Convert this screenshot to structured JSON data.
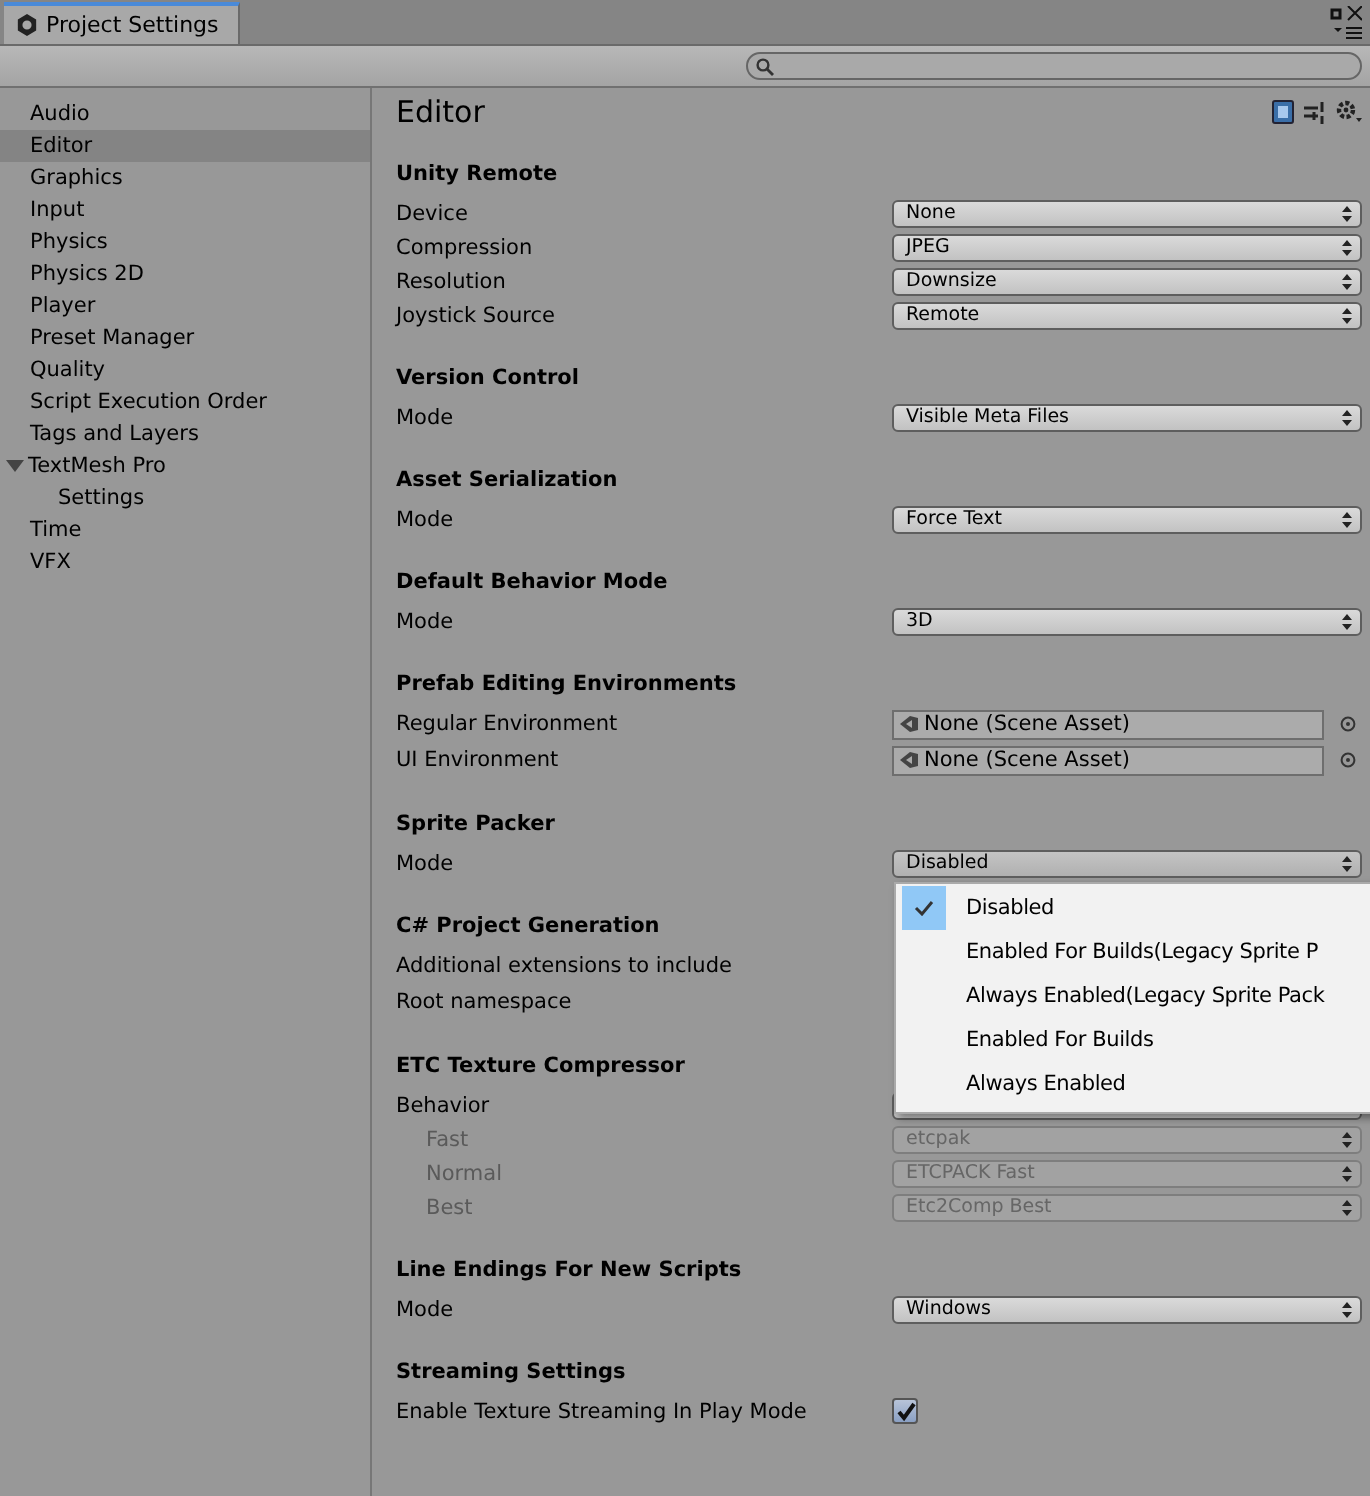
{
  "window": {
    "tab": "Project Settings"
  },
  "sidebar": {
    "items": [
      {
        "label": "Audio",
        "selected": false
      },
      {
        "label": "Editor",
        "selected": true
      },
      {
        "label": "Graphics",
        "selected": false
      },
      {
        "label": "Input",
        "selected": false
      },
      {
        "label": "Physics",
        "selected": false
      },
      {
        "label": "Physics 2D",
        "selected": false
      },
      {
        "label": "Player",
        "selected": false
      },
      {
        "label": "Preset Manager",
        "selected": false
      },
      {
        "label": "Quality",
        "selected": false
      },
      {
        "label": "Script Execution Order",
        "selected": false
      },
      {
        "label": "Tags and Layers",
        "selected": false
      },
      {
        "label": "TextMesh Pro",
        "selected": false,
        "expanded": true,
        "children": [
          {
            "label": "Settings",
            "selected": false
          }
        ]
      },
      {
        "label": "Time",
        "selected": false
      },
      {
        "label": "VFX",
        "selected": false
      }
    ]
  },
  "panel": {
    "title": "Editor",
    "sections": [
      {
        "title": "Unity Remote",
        "rows": [
          {
            "kind": "popup",
            "label": "Device",
            "value": "None",
            "disabled": false
          },
          {
            "kind": "popup",
            "label": "Compression",
            "value": "JPEG",
            "disabled": false
          },
          {
            "kind": "popup",
            "label": "Resolution",
            "value": "Downsize",
            "disabled": false
          },
          {
            "kind": "popup",
            "label": "Joystick Source",
            "value": "Remote",
            "disabled": false
          }
        ]
      },
      {
        "title": "Version Control",
        "rows": [
          {
            "kind": "popup",
            "label": "Mode",
            "value": "Visible Meta Files",
            "disabled": false
          }
        ]
      },
      {
        "title": "Asset Serialization",
        "rows": [
          {
            "kind": "popup",
            "label": "Mode",
            "value": "Force Text",
            "disabled": false
          }
        ]
      },
      {
        "title": "Default Behavior Mode",
        "rows": [
          {
            "kind": "popup",
            "label": "Mode",
            "value": "3D",
            "disabled": false
          }
        ]
      },
      {
        "title": "Prefab Editing Environments",
        "rows": [
          {
            "kind": "object",
            "label": "Regular Environment",
            "value": "None (Scene Asset)"
          },
          {
            "kind": "object",
            "label": "UI Environment",
            "value": "None (Scene Asset)"
          }
        ]
      },
      {
        "title": "Sprite Packer",
        "rows": [
          {
            "kind": "popup",
            "label": "Mode",
            "value": "Disabled",
            "disabled": false,
            "open": true
          }
        ]
      },
      {
        "title": "C# Project Generation",
        "rows": [
          {
            "kind": "text",
            "label": "Additional extensions to include"
          },
          {
            "kind": "text",
            "label": "Root namespace"
          }
        ]
      },
      {
        "title": "ETC Texture Compressor",
        "rows": [
          {
            "kind": "popup",
            "label": "Behavior",
            "disabled": false,
            "children": [
              {
                "kind": "popup",
                "label": "Fast",
                "value": "etcpak",
                "disabled": true
              },
              {
                "kind": "popup",
                "label": "Normal",
                "value": "ETCPACK Fast",
                "disabled": true
              },
              {
                "kind": "popup",
                "label": "Best",
                "value": "Etc2Comp Best",
                "disabled": true
              }
            ]
          }
        ]
      },
      {
        "title": "Line Endings For New Scripts",
        "rows": [
          {
            "kind": "popup",
            "label": "Mode",
            "value": "Windows",
            "disabled": false
          }
        ]
      },
      {
        "title": "Streaming Settings",
        "rows": [
          {
            "kind": "check",
            "label": "Enable Texture Streaming In Play Mode",
            "checked": true
          }
        ]
      }
    ]
  },
  "menu": {
    "items": [
      {
        "label": "Disabled",
        "selected": true
      },
      {
        "label": "Enabled For Builds(Legacy Sprite P",
        "selected": false
      },
      {
        "label": "Always Enabled(Legacy Sprite Pack",
        "selected": false
      },
      {
        "label": "Enabled For Builds",
        "selected": false
      },
      {
        "label": "Always Enabled",
        "selected": false
      }
    ]
  }
}
